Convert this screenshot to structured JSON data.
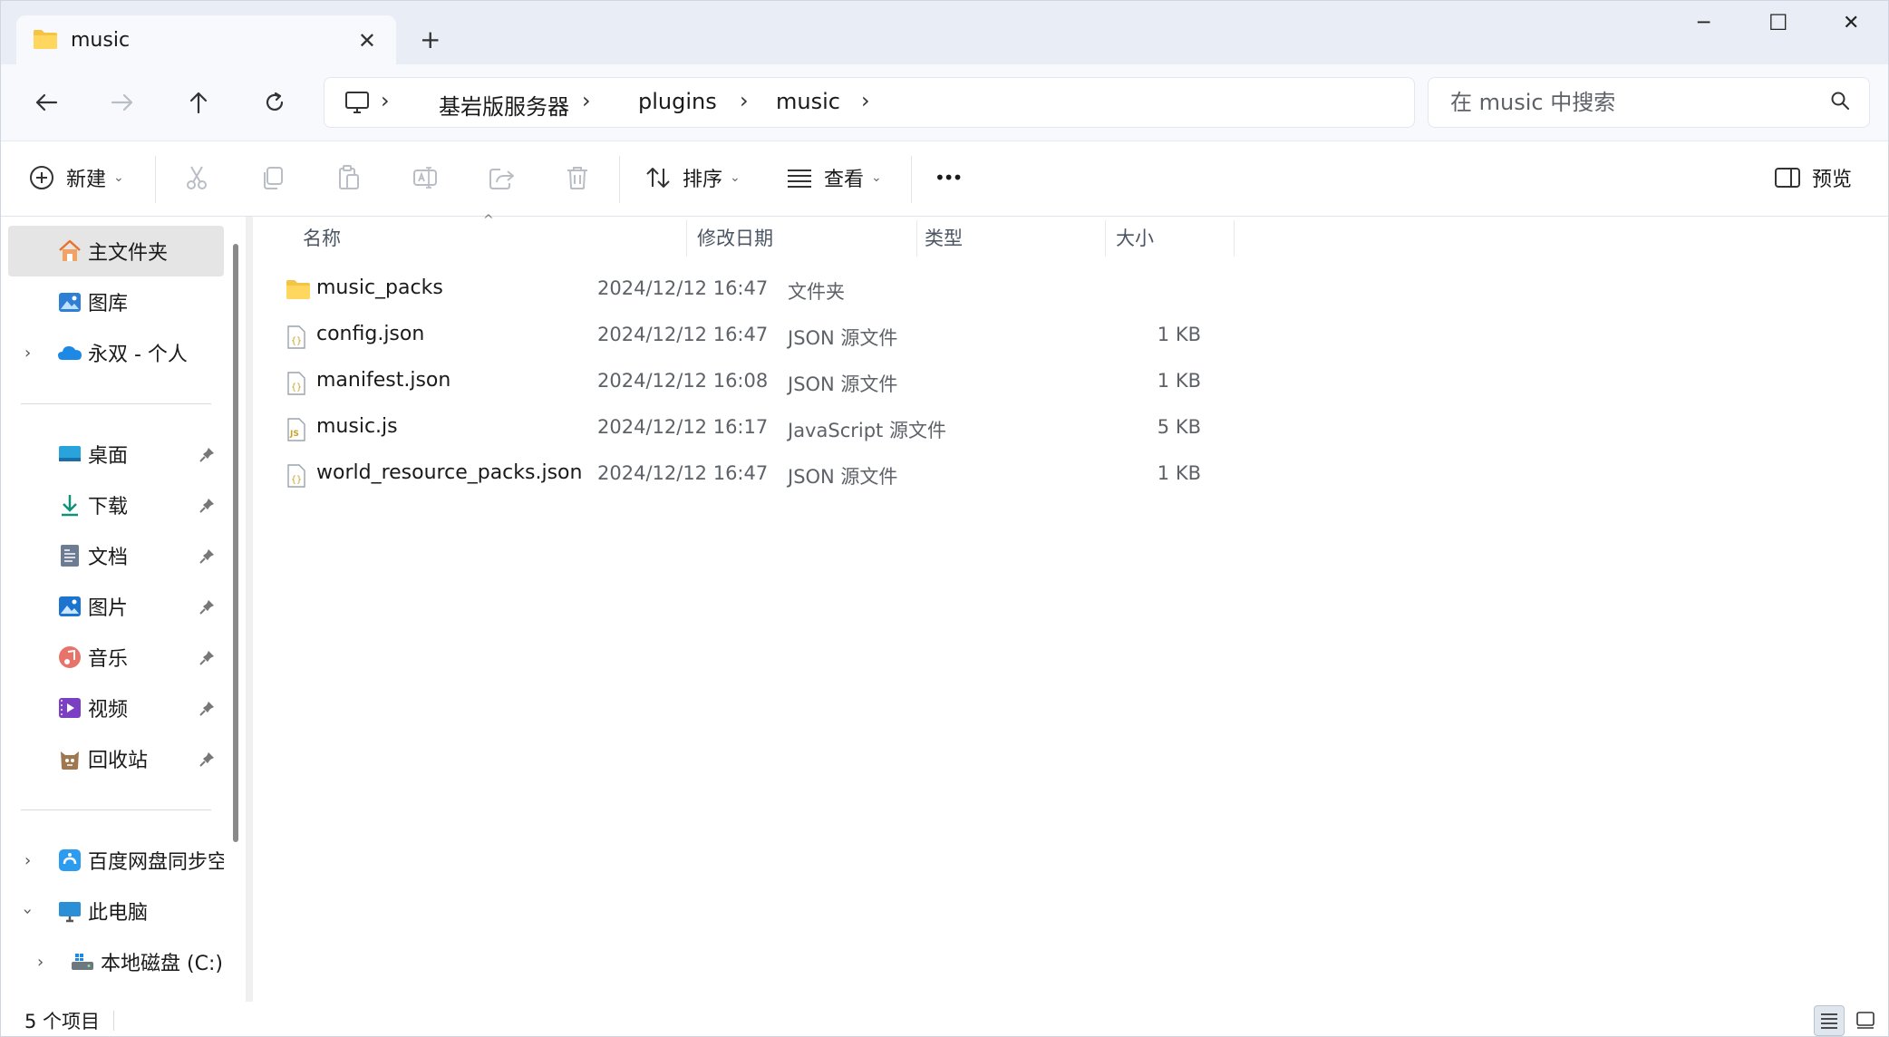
{
  "tab": {
    "title": "music"
  },
  "window": {
    "minimize": "─",
    "maximize": "☐",
    "close": "✕",
    "new_tab": "+"
  },
  "breadcrumb": [
    "基岩版服务器",
    "plugins",
    "music"
  ],
  "search": {
    "placeholder": "在 music 中搜索"
  },
  "toolbar": {
    "new_label": "新建",
    "sort_label": "排序",
    "view_label": "查看",
    "more_label": "•••",
    "preview_label": "预览"
  },
  "sidebar": {
    "top": [
      {
        "label": "主文件夹",
        "icon": "home-icon",
        "selected": true
      },
      {
        "label": "图库",
        "icon": "gallery-icon"
      },
      {
        "label": "永双 - 个人",
        "icon": "onedrive-icon",
        "expandable": true
      }
    ],
    "pinned": [
      {
        "label": "桌面",
        "icon": "desktop-icon"
      },
      {
        "label": "下载",
        "icon": "download-icon"
      },
      {
        "label": "文档",
        "icon": "documents-icon"
      },
      {
        "label": "图片",
        "icon": "pictures-icon"
      },
      {
        "label": "音乐",
        "icon": "music-icon"
      },
      {
        "label": "视频",
        "icon": "videos-icon"
      },
      {
        "label": "回收站",
        "icon": "recycle-bin-icon"
      }
    ],
    "bottom": [
      {
        "label": "百度网盘同步空间",
        "icon": "baidu-netdisk-icon"
      },
      {
        "label": "此电脑",
        "icon": "this-pc-icon"
      },
      {
        "label": "本地磁盘 (C:)",
        "icon": "local-disk-icon"
      }
    ]
  },
  "columns": {
    "name": "名称",
    "modified": "修改日期",
    "type": "类型",
    "size": "大小"
  },
  "files": [
    {
      "name": "music_packs",
      "modified": "2024/12/12 16:47",
      "type": "文件夹",
      "size": "",
      "icon": "folder-icon"
    },
    {
      "name": "config.json",
      "modified": "2024/12/12 16:47",
      "type": "JSON 源文件",
      "size": "1 KB",
      "icon": "json-file-icon"
    },
    {
      "name": "manifest.json",
      "modified": "2024/12/12 16:08",
      "type": "JSON 源文件",
      "size": "1 KB",
      "icon": "json-file-icon"
    },
    {
      "name": "music.js",
      "modified": "2024/12/12 16:17",
      "type": "JavaScript 源文件",
      "size": "5 KB",
      "icon": "js-file-icon"
    },
    {
      "name": "world_resource_packs.json",
      "modified": "2024/12/12 16:47",
      "type": "JSON 源文件",
      "size": "1 KB",
      "icon": "json-file-icon"
    }
  ],
  "status": {
    "item_count": "5 个项目"
  }
}
